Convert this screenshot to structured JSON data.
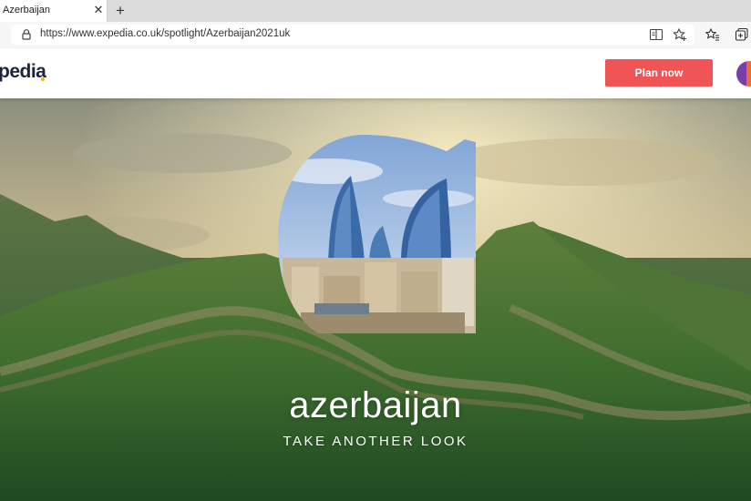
{
  "browser": {
    "tab_title": "Azerbaijan",
    "tab_close": "✕",
    "new_tab": "+",
    "url": "https://www.expedia.co.uk/spotlight/Azerbaijan2021uk"
  },
  "site": {
    "logo_text": "pedia",
    "plan_button": "Plan now"
  },
  "hero": {
    "title": "azerbaijan",
    "tagline": "TAKE ANOTHER LOOK"
  },
  "colors": {
    "accent_button": "#f05454",
    "logo": "#1e243a",
    "logo_dot": "#f2b500"
  }
}
